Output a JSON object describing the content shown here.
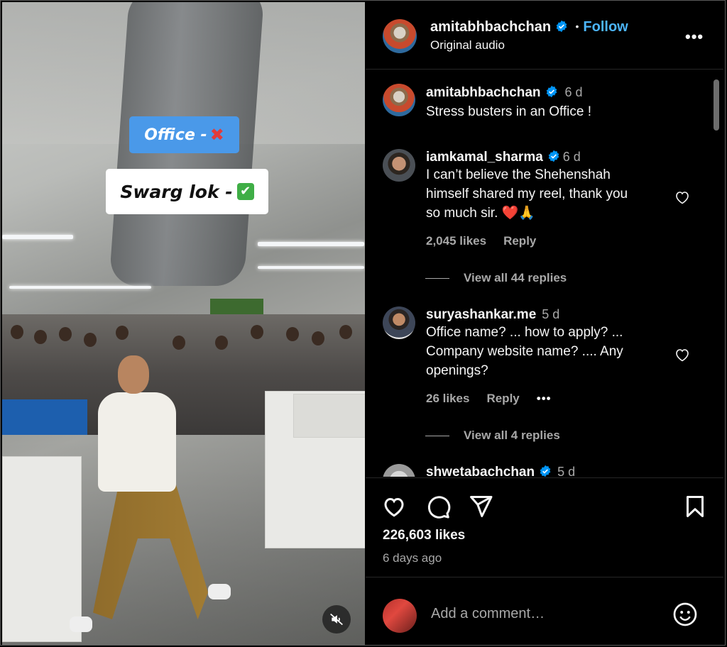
{
  "media": {
    "sticker_office_text": "Office -",
    "sticker_office_emoji": "✖",
    "sticker_swarg_text": "Swarg lok -",
    "sticker_swarg_emoji": "✔",
    "mute_icon": "speaker-muted-icon"
  },
  "header": {
    "username": "amitabhbachchan",
    "separator": "•",
    "follow_label": "Follow",
    "audio": "Original audio",
    "more_label": "•••"
  },
  "comments": [
    {
      "username": "amitabhbachchan",
      "time": "6 d",
      "text": "Stress busters in an Office !"
    },
    {
      "username": "iamkamal_sharma",
      "time": "6 d",
      "text_lines": [
        "I can’t believe the Shehenshah",
        "himself shared my reel, thank you",
        "so much sir. ❤️🙏"
      ],
      "likes": "2,045 likes",
      "reply_label": "Reply",
      "view_replies": "View all 44 replies"
    },
    {
      "username": "suryashankar.me",
      "time": "5 d",
      "text_lines": [
        "Office name? ... how to apply? ...",
        "Company website name? .... Any",
        "openings?"
      ],
      "likes": "26 likes",
      "reply_label": "Reply",
      "more_label": "•••",
      "view_replies": "View all 4 replies"
    },
    {
      "username": "shwetabachchan",
      "time": "5 d"
    }
  ],
  "actions": {
    "likes": "226,603 likes",
    "date": "6 days ago"
  },
  "add_comment": {
    "placeholder": "Add a comment…"
  },
  "colors": {
    "accent": "#4cb5f9",
    "verified": "#0095f6",
    "secondary_text": "#a8a8a8",
    "sticker_blue": "#4a99e9"
  }
}
